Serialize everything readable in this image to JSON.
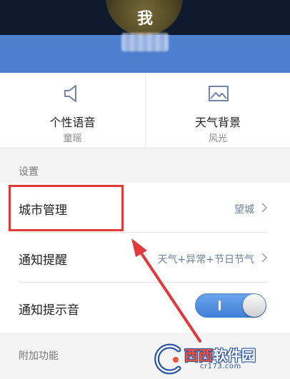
{
  "header": {
    "title": "我"
  },
  "features": [
    {
      "title": "个性语音",
      "subtitle": "童瑶",
      "icon": "speaker-icon"
    },
    {
      "title": "天气背景",
      "subtitle": "风光",
      "icon": "landscape-image-icon"
    }
  ],
  "settings": {
    "section_label": "设置",
    "items": [
      {
        "label": "城市管理",
        "value": "望城",
        "icon": "chevron-right-icon"
      },
      {
        "label": "通知提醒",
        "value": "天气+异常+节日节气",
        "icon": "chevron-right-icon"
      },
      {
        "label": "通知提示音",
        "toggle_on": true
      }
    ]
  },
  "extras": {
    "section_label": "附加功能"
  },
  "colors": {
    "header_dark": "#101a2e",
    "header_band": "#4e7fcf",
    "toggle_on": "#4a8ae0",
    "highlight": "#e03a3a",
    "value_text": "#6a7f9a"
  },
  "watermark": {
    "brand_part1": "西西",
    "brand_part2": "软件园",
    "url": "cr173.com"
  }
}
